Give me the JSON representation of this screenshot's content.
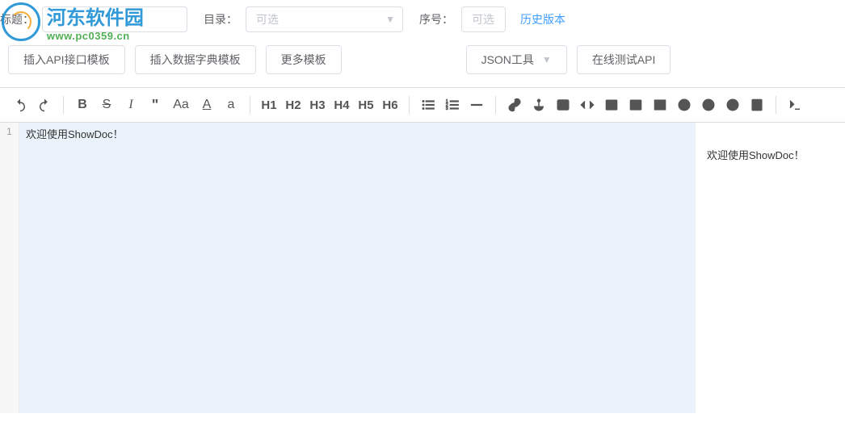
{
  "watermark": {
    "title": "河东软件园",
    "url": "www.pc0359.cn"
  },
  "topRow": {
    "titleLabel": "标题：",
    "dirLabel": "目录：",
    "dirPlaceholder": "可选",
    "seqLabel": "序号：",
    "seqPlaceholder": "可选",
    "historyLink": "历史版本"
  },
  "buttons": {
    "apiTemplate": "插入API接口模板",
    "dictTemplate": "插入数据字典模板",
    "moreTemplate": "更多模板",
    "jsonTool": "JSON工具",
    "testApi": "在线测试API"
  },
  "toolbar": {
    "h1": "H1",
    "h2": "H2",
    "h3": "H3",
    "h4": "H4",
    "h5": "H5",
    "h6": "H6"
  },
  "editor": {
    "lineNum": "1",
    "content": "欢迎使用ShowDoc！"
  },
  "preview": {
    "content": "欢迎使用ShowDoc！"
  }
}
